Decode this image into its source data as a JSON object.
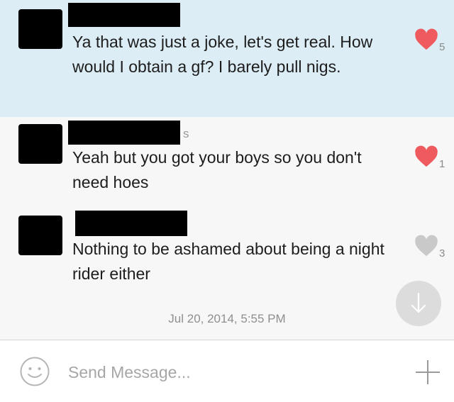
{
  "messages": [
    {
      "name_suffix": "",
      "text": "Ya that was just a joke, let's get real. How would I obtain a gf? I barely pull nigs.",
      "likes": "5",
      "liked": true
    },
    {
      "name_suffix": "s",
      "text": "Yeah but you got your boys so you don't need hoes",
      "likes": "1",
      "liked": true
    },
    {
      "name_suffix": "",
      "text": "Nothing to be ashamed about being a night rider either",
      "likes": "3",
      "liked": false
    }
  ],
  "timestamp": "Jul 20, 2014, 5:55 PM",
  "composer": {
    "placeholder": "Send Message..."
  },
  "colors": {
    "highlight_bg": "#dcedf6",
    "liked_heart": "#ef5a5f",
    "unliked_heart": "#c9c9c9"
  }
}
